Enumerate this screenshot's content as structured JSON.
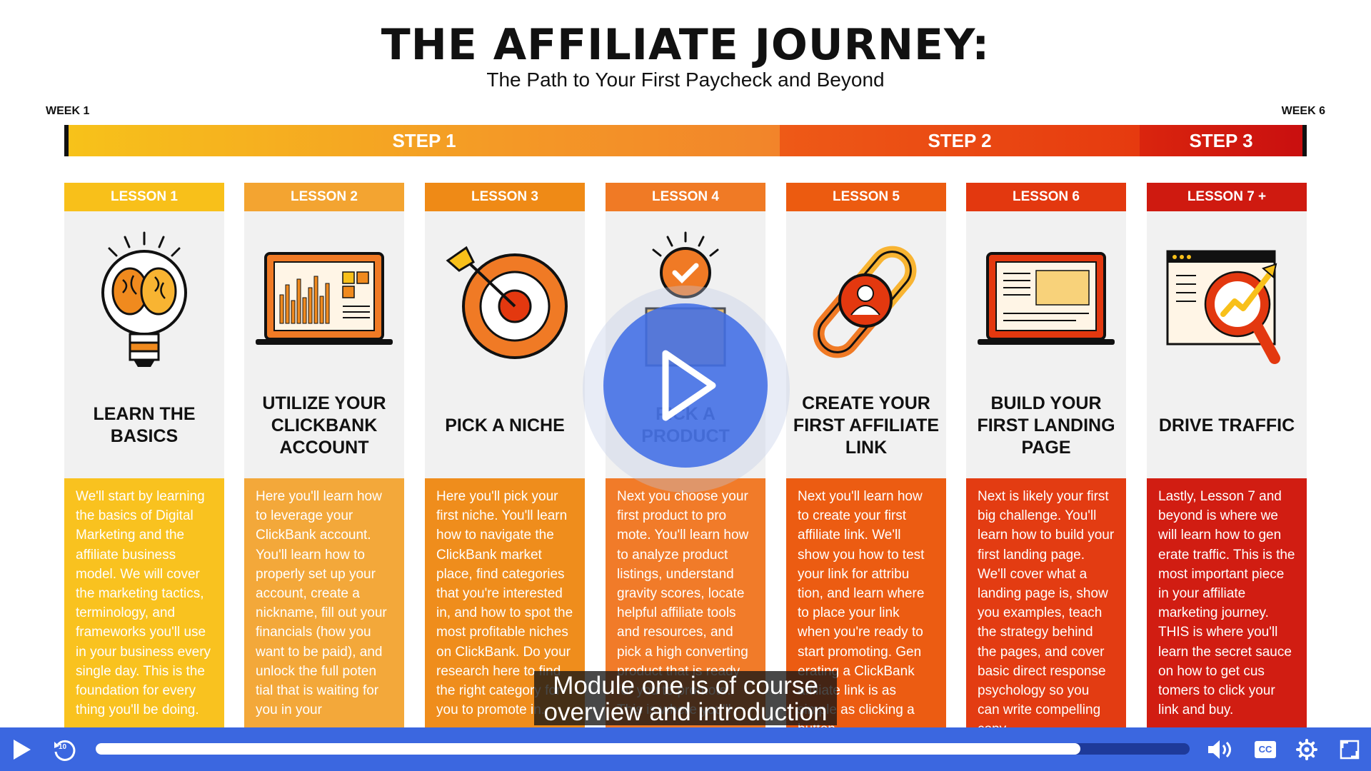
{
  "header": {
    "title": "THE AFFILIATE JOURNEY:",
    "subtitle": "The Path to Your First Paycheck and Beyond",
    "week_start": "WEEK 1",
    "week_end": "WEEK 6"
  },
  "steps": [
    "STEP 1",
    "STEP 2",
    "STEP 3"
  ],
  "lessons": [
    {
      "label": "LESSON 1",
      "title": "LEARN THE BASICS",
      "icon": "lightbulb-brain-icon",
      "color": "#f8c01a",
      "bg": "#f9c21f",
      "desc": "We'll start by learning the basics of Digital Marketing and the affiliate business model. We will cover the marketing tactics, terminology, and frameworks you'll use in your business every single day. This is the foundation for every thing you'll be doing."
    },
    {
      "label": "LESSON 2",
      "title": "UTILIZE YOUR CLICKBANK ACCOUNT",
      "icon": "laptop-chart-icon",
      "color": "#f3a431",
      "bg": "#f3a83a",
      "desc": "Here you'll learn how to leverage your ClickBank account. You'll learn how to properly set up your account, create a nickname, fill out your financials (how you want to be paid), and unlock the full poten tial that is waiting for you in your"
    },
    {
      "label": "LESSON 3",
      "title": "PICK A NICHE",
      "icon": "target-icon",
      "color": "#ef8a16",
      "bg": "#ef8d1c",
      "desc": "Here you'll pick your first niche. You'll learn how to navigate the ClickBank market place, find categories that you're interested in, and how to spot the most profitable niches on ClickBank. Do your research here to find the right category for you to promote in."
    },
    {
      "label": "LESSON 4",
      "title": "PICK A PRODUCT",
      "icon": "box-check-icon",
      "color": "#f07a25",
      "bg": "#f17b29",
      "desc": "Next you choose your first product to pro mote. You'll learn how to analyze product listings, understand gravity scores, locate helpful affiliate tools and resources, and pick a high converting product that is ready for you to promote. This is where you'll"
    },
    {
      "label": "LESSON 5",
      "title": "CREATE YOUR FIRST AFFILIATE LINK",
      "icon": "link-user-icon",
      "color": "#ec5b10",
      "bg": "#ec5c12",
      "desc": "Next you'll learn how to create your first affiliate link. We'll show you how to test your link for attribu tion, and learn where to place your link when you're ready to start promoting. Gen erating a ClickBank affiliate link is as simple as clicking a button."
    },
    {
      "label": "LESSON 6",
      "title": "BUILD YOUR FIRST LANDING PAGE",
      "icon": "laptop-page-icon",
      "color": "#e3380f",
      "bg": "#e33c12",
      "desc": "Next is likely your first big challenge. You'll learn how to build your first landing page. We'll cover what a landing page is, show you examples, teach the strategy behind the pages, and cover basic direct response psychology so you can write compelling copy."
    },
    {
      "label": "LESSON 7 +",
      "title": "DRIVE TRAFFIC",
      "icon": "magnifier-growth-icon",
      "color": "#cf1a10",
      "bg": "#d11d12",
      "desc": "Lastly, Lesson 7 and beyond is where we will learn how to gen erate traffic. This is the most important piece in your affiliate marketing journey. THIS is where you'll learn the secret sauce on how to get cus tomers to click your link and buy."
    }
  ],
  "player": {
    "caption": "Module one is of course overview and introduction",
    "progress": 0.9,
    "play_icon": "play-icon",
    "rewind_label": "10",
    "cc_label": "CC"
  }
}
